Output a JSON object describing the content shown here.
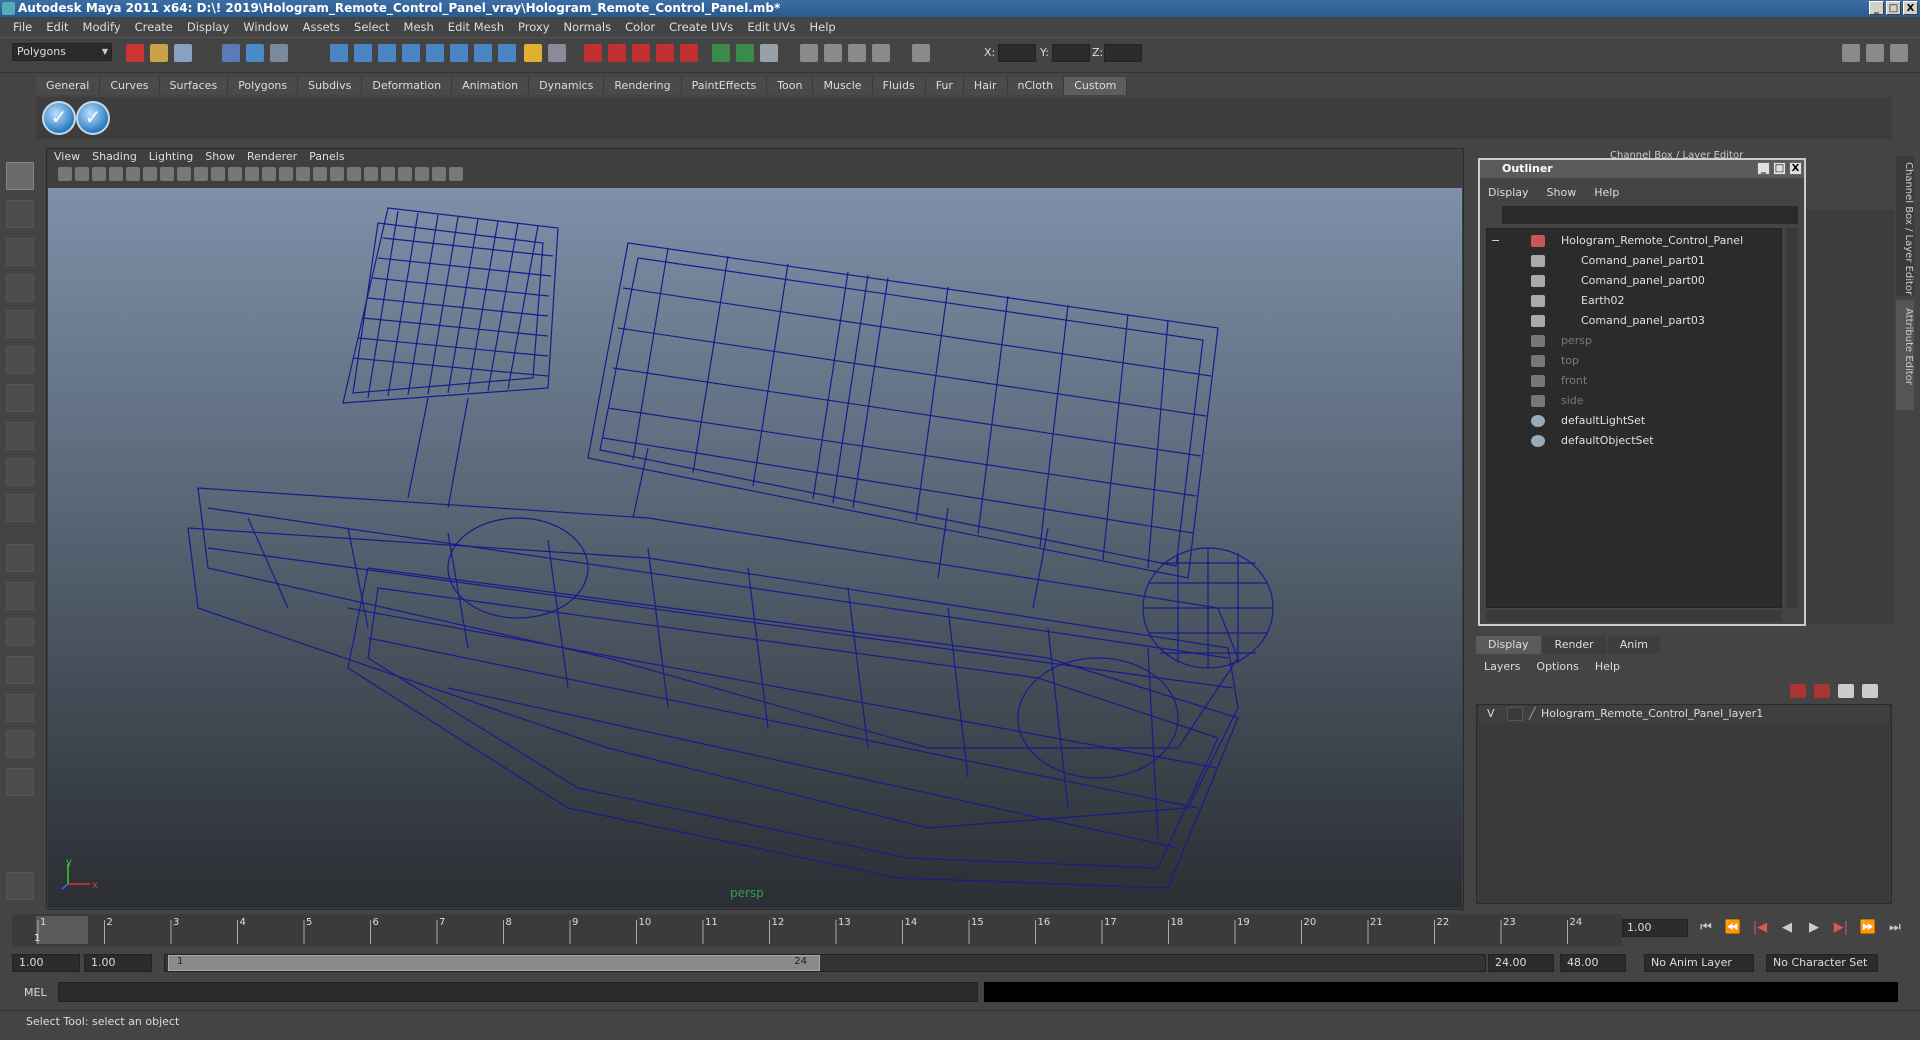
{
  "window": {
    "title": "Autodesk Maya 2011 x64: D:\\! 2019\\Hologram_Remote_Control_Panel_vray\\Hologram_Remote_Control_Panel.mb*",
    "min": "_",
    "max": "□",
    "close": "X"
  },
  "menubar": [
    "File",
    "Edit",
    "Modify",
    "Create",
    "Display",
    "Window",
    "Assets",
    "Select",
    "Mesh",
    "Edit Mesh",
    "Proxy",
    "Normals",
    "Color",
    "Create UVs",
    "Edit UVs",
    "Help"
  ],
  "status": {
    "mode": "Polygons",
    "x_label": "X:",
    "y_label": "Y:",
    "z_label": "Z:"
  },
  "shelf": {
    "tabs": [
      "General",
      "Curves",
      "Surfaces",
      "Polygons",
      "Subdivs",
      "Deformation",
      "Animation",
      "Dynamics",
      "Rendering",
      "PaintEffects",
      "Toon",
      "Muscle",
      "Fluids",
      "Fur",
      "Hair",
      "nCloth",
      "Custom"
    ],
    "active": "Custom"
  },
  "viewport": {
    "menu": [
      "View",
      "Shading",
      "Lighting",
      "Show",
      "Renderer",
      "Panels"
    ],
    "camera_label": "persp",
    "axis_x": "x",
    "axis_y": "y",
    "wire_color": "#1a1a8c"
  },
  "outliner": {
    "title": "Outliner",
    "menu": [
      "Display",
      "Show",
      "Help"
    ],
    "items": [
      {
        "label": "Hologram_Remote_Control_Panel",
        "dim": false
      },
      {
        "label": "Comand_panel_part01",
        "dim": false
      },
      {
        "label": "Comand_panel_part00",
        "dim": false
      },
      {
        "label": "Earth02",
        "dim": false
      },
      {
        "label": "Comand_panel_part03",
        "dim": false
      },
      {
        "label": "persp",
        "dim": true
      },
      {
        "label": "top",
        "dim": true
      },
      {
        "label": "front",
        "dim": true
      },
      {
        "label": "side",
        "dim": true
      },
      {
        "label": "defaultLightSet",
        "dim": false
      },
      {
        "label": "defaultObjectSet",
        "dim": false
      }
    ],
    "expand": "−"
  },
  "channel_box": {
    "title": "Channel Box / Layer Editor",
    "side_tab_1": "Channel Box / Layer Editor",
    "side_tab_2": "Attribute Editor"
  },
  "layers": {
    "tabs": [
      "Display",
      "Render",
      "Anim"
    ],
    "active": "Display",
    "menu": [
      "Layers",
      "Options",
      "Help"
    ],
    "layer_visible": "V",
    "layer_name": "Hologram_Remote_Control_Panel_layer1"
  },
  "timeline": {
    "ticks": [
      "1",
      "2",
      "3",
      "4",
      "5",
      "6",
      "7",
      "8",
      "9",
      "10",
      "11",
      "12",
      "13",
      "14",
      "15",
      "16",
      "17",
      "18",
      "19",
      "20",
      "21",
      "22",
      "23",
      "24"
    ],
    "current": "1.00",
    "current_marker": "1"
  },
  "range": {
    "start": "1.00",
    "anim_start": "1.00",
    "slider_start": "1",
    "slider_end": "24",
    "end": "24.00",
    "anim_end": "48.00",
    "anim_layer": "No Anim Layer",
    "char_set": "No Character Set"
  },
  "command": {
    "label": "MEL"
  },
  "help_line": "Select Tool: select an object"
}
